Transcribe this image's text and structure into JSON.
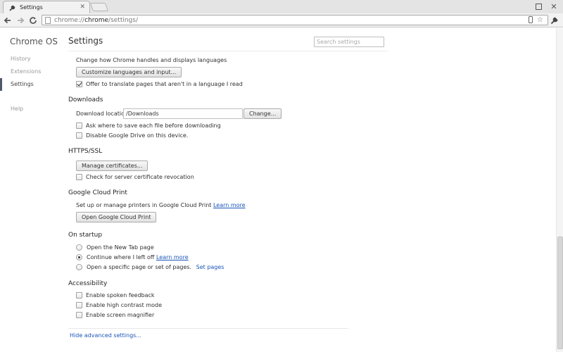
{
  "browser": {
    "tab_title": "Settings",
    "url_prefix": "chrome://",
    "url_host": "chrome",
    "url_path": "/settings/"
  },
  "sidebar": {
    "brand": "Chrome OS",
    "items": [
      {
        "label": "History"
      },
      {
        "label": "Extensions"
      },
      {
        "label": "Settings"
      },
      {
        "label": "Help"
      }
    ]
  },
  "header": {
    "title": "Settings",
    "search_placeholder": "Search settings"
  },
  "languages": {
    "description": "Change how Chrome handles and displays languages",
    "customize_button": "Customize languages and input...",
    "translate_label": "Offer to translate pages that aren't in a language I read",
    "translate_checked": true
  },
  "downloads": {
    "title": "Downloads",
    "location_label": "Download location:",
    "location_value": "/Downloads",
    "change_button": "Change...",
    "ask_label": "Ask where to save each file before downloading",
    "disable_drive_label": "Disable Google Drive on this device."
  },
  "https": {
    "title": "HTTPS/SSL",
    "manage_button": "Manage certificates...",
    "revocation_label": "Check for server certificate revocation"
  },
  "cloud_print": {
    "title": "Google Cloud Print",
    "description": "Set up or manage printers in Google Cloud Print",
    "learn_more": "Learn more",
    "open_button": "Open Google Cloud Print"
  },
  "startup": {
    "title": "On startup",
    "options": [
      {
        "label": "Open the New Tab page"
      },
      {
        "label": "Continue where I left off",
        "link": "Learn more"
      },
      {
        "label": "Open a specific page or set of pages.",
        "link": "Set pages"
      }
    ],
    "selected_index": 1
  },
  "accessibility": {
    "title": "Accessibility",
    "options": [
      {
        "label": "Enable spoken feedback"
      },
      {
        "label": "Enable high contrast mode"
      },
      {
        "label": "Enable screen magnifier"
      }
    ]
  },
  "footer": {
    "hide_advanced": "Hide advanced settings..."
  },
  "colors": {
    "link": "#1a55b8",
    "active_marker": "#4e5a6a"
  }
}
